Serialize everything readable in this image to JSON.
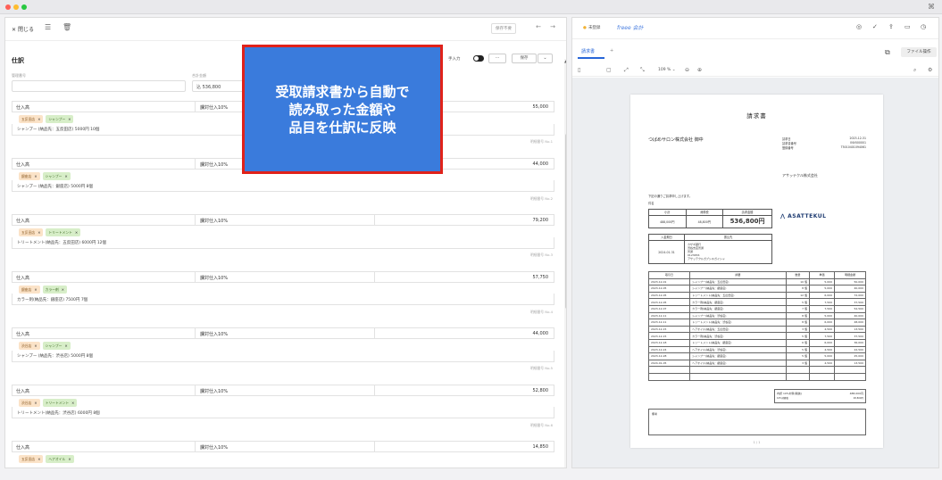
{
  "window": {
    "grid_icon": "⌘"
  },
  "left": {
    "header": {
      "close_label": "閉じる",
      "exit_label": "保存不要",
      "prev": "←",
      "next": "→"
    },
    "title": "仕訳",
    "manual_input_label": "手入力",
    "more_label": "···",
    "save_label": "保存",
    "dropdown_label": "⌄",
    "fields": [
      {
        "label": "管理番号",
        "value": ""
      },
      {
        "label": "合計金額",
        "value": "込 536,800"
      }
    ],
    "entries": [
      {
        "account": "仕入高",
        "tax": "課対仕入10%",
        "amount": "55,000",
        "partner": "五反田店",
        "item": "シャンプー",
        "desc": "シャンプー (納品先：五反田店) 5000円 10個",
        "receipt": "明細番号 No.1"
      },
      {
        "account": "仕入高",
        "tax": "課対仕入10%",
        "amount": "44,000",
        "partner": "銀座店",
        "item": "シャンプー",
        "desc": "シャンプー (納品先：銀座店) 5000円 8個",
        "receipt": "明細番号 No.2"
      },
      {
        "account": "仕入高",
        "tax": "課対仕入10%",
        "amount": "79,200",
        "partner": "五反田店",
        "item": "トリートメント",
        "desc": "トリートメント(納品先：五反田店) 6000円 12個",
        "receipt": "明細番号 No.3"
      },
      {
        "account": "仕入高",
        "tax": "課対仕入10%",
        "amount": "57,750",
        "partner": "銀座店",
        "item": "カラー剤",
        "desc": "カラー剤(納品先：銀座店) 7500円 7個",
        "receipt": "明細番号 No.4"
      },
      {
        "account": "仕入高",
        "tax": "課対仕入10%",
        "amount": "44,000",
        "partner": "渋谷店",
        "item": "シャンプー",
        "desc": "シャンプー (納品先：渋谷店) 5000円 8個",
        "receipt": "明細番号 No.5"
      },
      {
        "account": "仕入高",
        "tax": "課対仕入10%",
        "amount": "52,800",
        "partner": "渋谷店",
        "item": "トリートメント",
        "desc": "トリートメント(納品先：渋谷店) 6000円 8個",
        "receipt": "明細番号 No.6"
      },
      {
        "account": "仕入高",
        "tax": "課対仕入10%",
        "amount": "14,850",
        "partner": "五反田店",
        "item": "ヘアオイル",
        "desc": "",
        "receipt": ""
      }
    ]
  },
  "callout": {
    "line1": "受取請求書から自動で",
    "line2": "読み取った金額や",
    "line3": "品目を仕訳に反映"
  },
  "right": {
    "status": "未登録",
    "logo": "freee 会計",
    "tab": "請求書",
    "tab_add": "+",
    "file_ops": "ファイル操作",
    "zoom": "109 % ⌄",
    "invoice": {
      "title": "請求書",
      "to": "つばめサロン株式会社 御中",
      "meta": [
        {
          "k": "請求日",
          "v": "2023-12-31"
        },
        {
          "k": "請求書番号",
          "v": "INV000001"
        },
        {
          "k": "登録番号",
          "v": "T5010401094061"
        }
      ],
      "company": "アサッテクル株式会社",
      "note": "下記の通りご請求申し上げます。",
      "subject": "件名",
      "summary": {
        "h_subtotal": "小計",
        "h_tax": "消費税",
        "h_total": "請求金額",
        "subtotal": "488,000円",
        "tax": "48,800円",
        "total": "536,800円"
      },
      "brand": "ASATTEKUL",
      "bank": {
        "h_due": "入金期日",
        "h_account": "振込先",
        "due": "2024-01-31",
        "lines": [
          "カザギ銀行",
          "渋谷支店普通",
          "普通",
          "0123456",
          "アサッテクルガブシキガイシャ"
        ]
      },
      "columns": [
        "取引日",
        "摘要",
        "数量",
        "単価",
        "明細金額"
      ],
      "rows": [
        [
          "2023-12-01",
          "シャンプー(納品先：五反田店)",
          "10 個",
          "5,000",
          "50,000"
        ],
        [
          "2023-12-05",
          "シャンプー(納品先：銀座店)",
          "8 個",
          "5,000",
          "40,000"
        ],
        [
          "2023-12-05",
          "トリートメント(納品先：五反田店)",
          "12 個",
          "6,000",
          "72,000"
        ],
        [
          "2023-12-05",
          "カラー剤(納品先：銀座店)",
          "5 個",
          "7,500",
          "37,500"
        ],
        [
          "2023-12-07",
          "カラー剤(納品先：銀座店)",
          "7 個",
          "7,500",
          "52,500"
        ],
        [
          "2023-12-11",
          "シャンプー(納品先：渋谷店)",
          "8 個",
          "5,000",
          "40,000"
        ],
        [
          "2023-12-11",
          "トリートメント(納品先：渋谷店)",
          "8 個",
          "6,000",
          "48,000"
        ],
        [
          "2023-12-15",
          "ヘアオイル(納品先：五反田店)",
          "3 個",
          "4,500",
          "13,500"
        ],
        [
          "2023-12-15",
          "カラー剤(納品先：渋谷店)",
          "5 個",
          "7,500",
          "37,500"
        ],
        [
          "2023-12-18",
          "トリートメント(納品先：銀座店)",
          "6 個",
          "6,000",
          "36,000"
        ],
        [
          "2023-12-24",
          "ヘアオイル(納品先：渋谷店)",
          "5 個",
          "4,500",
          "22,500"
        ],
        [
          "2023-12-28",
          "シャンプー(納品先：銀座店)",
          "5 個",
          "5,000",
          "25,000"
        ],
        [
          "2024-01-05",
          "ヘアオイル(納品先：銀座店)",
          "3 個",
          "4,500",
          "13,500"
        ],
        [
          "",
          "",
          "",
          "",
          ""
        ],
        [
          "",
          "",
          "",
          "",
          ""
        ]
      ],
      "total_label": "内訳  10%対象(税抜)",
      "total_value": "488,000円",
      "tax_label": "10%消費税",
      "tax_value": "48,800円",
      "remark_label": "備考",
      "page": "1 / 1"
    }
  }
}
